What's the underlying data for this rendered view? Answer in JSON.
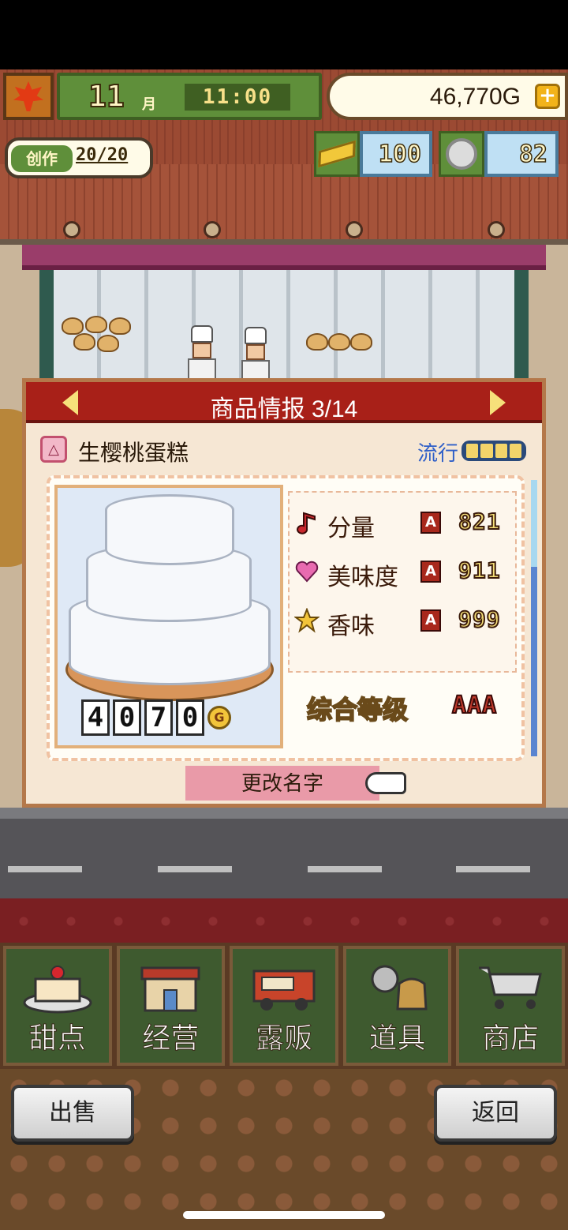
{
  "hud": {
    "season_icon": "maple-leaf-icon",
    "month": "11",
    "month_unit": "月",
    "time": "11:00",
    "money": "46,770G",
    "create_label": "创作",
    "create_value": "20/20",
    "gold_bars": "100",
    "medals": "82"
  },
  "panel": {
    "title": "商品情报 3/14",
    "item_name": "生樱桃蛋糕",
    "trend_label": "流行",
    "trend_level": 4,
    "trend_max": 4,
    "price_digits": [
      "4",
      "0",
      "7",
      "0"
    ],
    "price_unit": "G",
    "stats": [
      {
        "label": "分量",
        "rank": "A",
        "value": "821",
        "icon": "music-note-icon",
        "color": "#c8282e"
      },
      {
        "label": "美味度",
        "rank": "A",
        "value": "911",
        "icon": "heart-icon",
        "color": "#e86bb0"
      },
      {
        "label": "香味",
        "rank": "A",
        "value": "999",
        "icon": "star-icon",
        "color": "#f2c43a"
      }
    ],
    "overall_label": "综合等级",
    "overall_value": "AAA",
    "rename_label": "更改名字"
  },
  "nav": {
    "items": [
      {
        "label": "甜点",
        "icon": "cake-icon"
      },
      {
        "label": "经营",
        "icon": "shop-icon"
      },
      {
        "label": "露贩",
        "icon": "food-truck-icon"
      },
      {
        "label": "道具",
        "icon": "items-bag-icon"
      },
      {
        "label": "商店",
        "icon": "shopping-cart-icon"
      }
    ]
  },
  "footer": {
    "sell_label": "出售",
    "back_label": "返回"
  }
}
